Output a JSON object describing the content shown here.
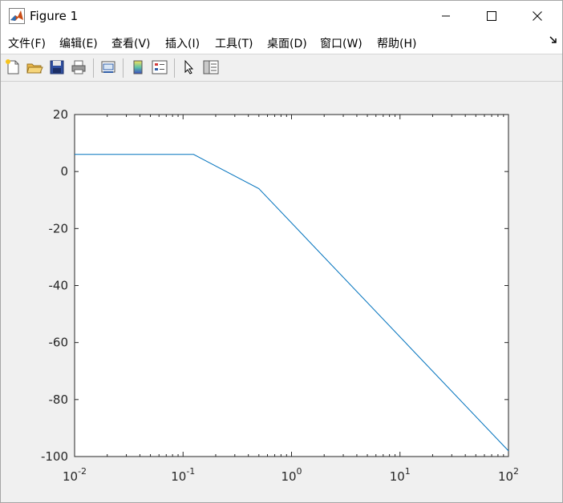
{
  "window": {
    "title": "Figure 1",
    "controls": [
      "minimize",
      "maximize",
      "close"
    ]
  },
  "menu": [
    {
      "label": "文件(F)"
    },
    {
      "label": "编辑(E)"
    },
    {
      "label": "查看(V)"
    },
    {
      "label": "插入(I)"
    },
    {
      "label": "工具(T)"
    },
    {
      "label": "桌面(D)"
    },
    {
      "label": "窗口(W)"
    },
    {
      "label": "帮助(H)"
    }
  ],
  "toolbar": {
    "icons": [
      "new-figure-icon",
      "open-file-icon",
      "save-icon",
      "print-icon",
      "link-plot-icon",
      "colorbar-icon",
      "legend-icon",
      "pointer-icon",
      "property-editor-icon"
    ]
  },
  "chart_data": {
    "type": "line",
    "x_scale": "log",
    "xlim": [
      0.01,
      100
    ],
    "ylim": [
      -100,
      20
    ],
    "x_ticks": [
      {
        "base": "10",
        "exp": "-2",
        "value": 0.01
      },
      {
        "base": "10",
        "exp": "-1",
        "value": 0.1
      },
      {
        "base": "10",
        "exp": "0",
        "value": 1
      },
      {
        "base": "10",
        "exp": "1",
        "value": 10
      },
      {
        "base": "10",
        "exp": "2",
        "value": 100
      }
    ],
    "y_ticks": [
      20,
      0,
      -20,
      -40,
      -60,
      -80,
      -100
    ],
    "y_tick_labels": [
      "20",
      "0",
      "-20",
      "-40",
      "-60",
      "-80",
      "-100"
    ],
    "series": [
      {
        "color": "#0072bd",
        "x": [
          0.01,
          0.125,
          0.5,
          100
        ],
        "y": [
          6,
          6,
          -6,
          -98
        ]
      }
    ],
    "grid": false,
    "legend": "none"
  }
}
